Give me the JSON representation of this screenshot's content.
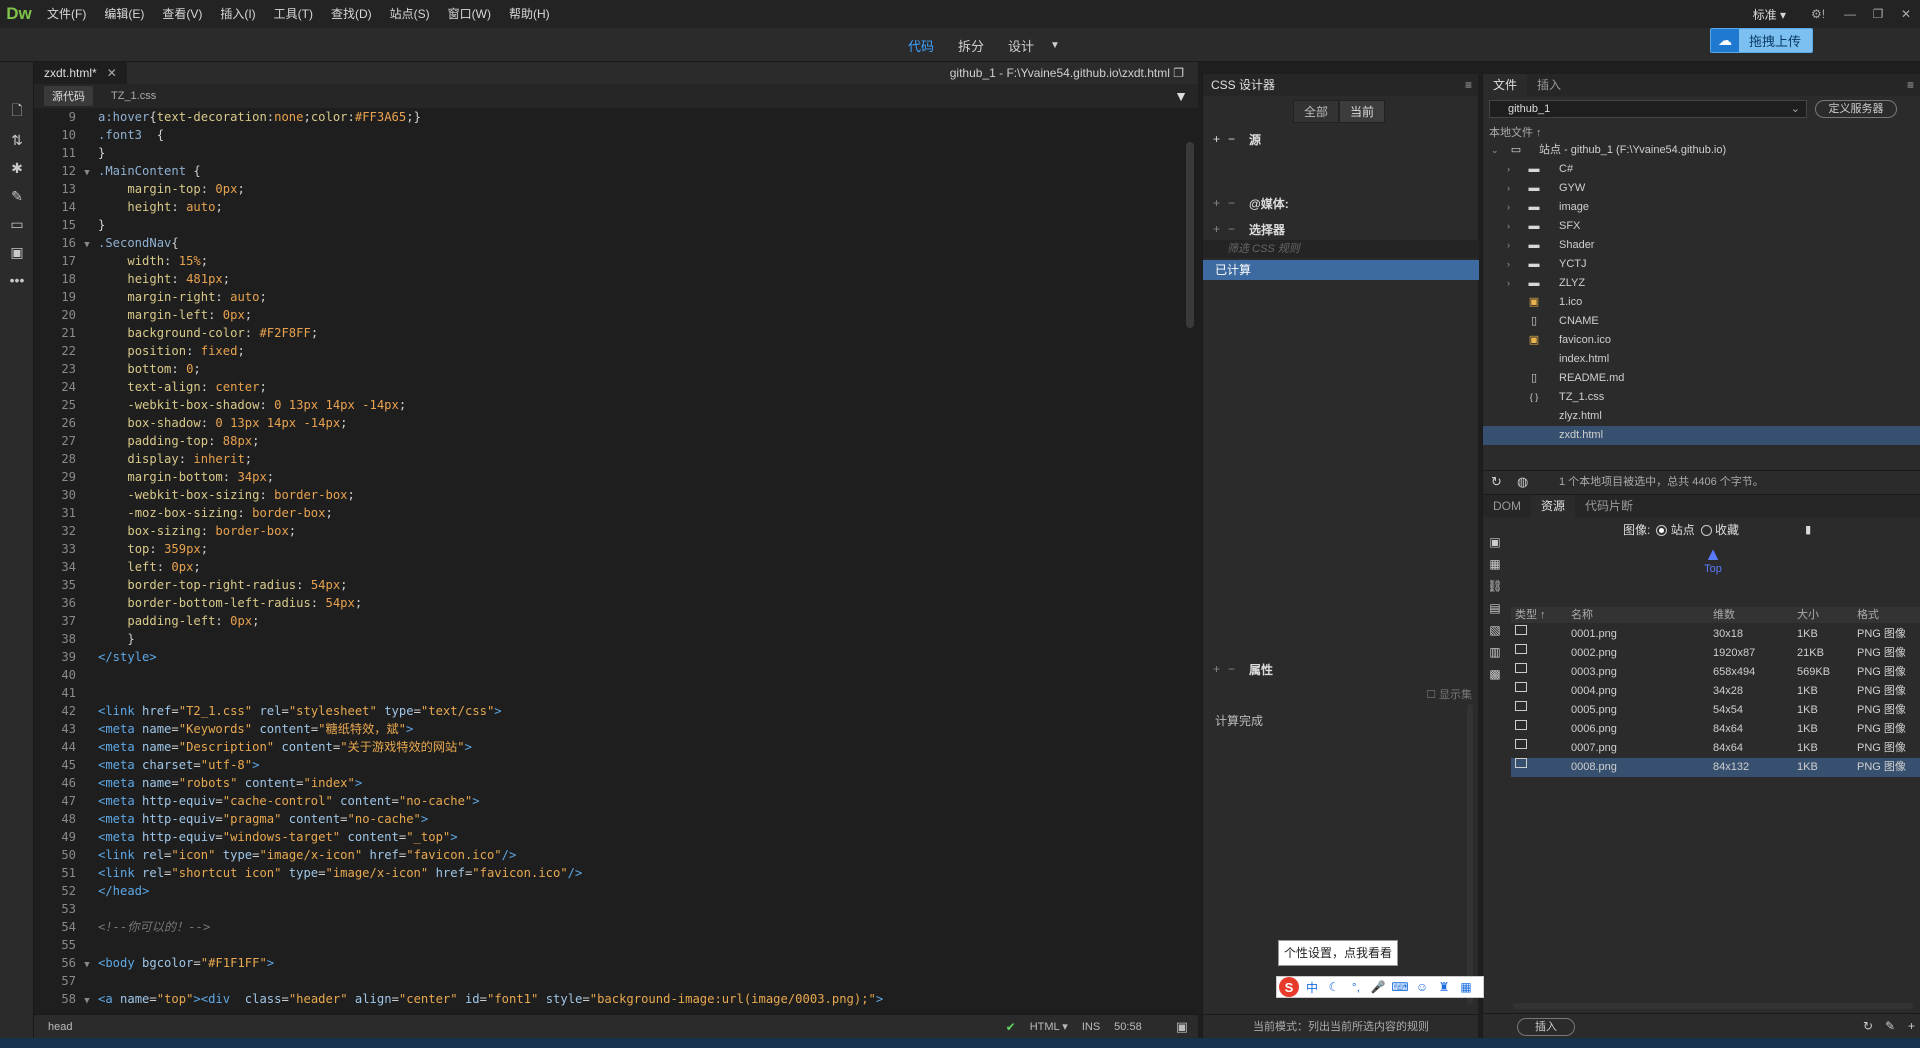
{
  "app": {
    "logo": "Dw"
  },
  "menu": [
    "文件(F)",
    "编辑(E)",
    "查看(V)",
    "插入(I)",
    "工具(T)",
    "查找(D)",
    "站点(S)",
    "窗口(W)",
    "帮助(H)"
  ],
  "workspace": "标准",
  "views": {
    "code": "代码",
    "split": "拆分",
    "design": "设计"
  },
  "upload_label": "拖拽上传",
  "doc": {
    "tab": "zxdt.html*",
    "path": "github_1 - F:\\Yvaine54.github.io\\zxdt.html",
    "subtabs": [
      "源代码",
      "TZ_1.css"
    ]
  },
  "code_lines": [
    {
      "n": "9",
      "f": "",
      "html": "<span class='c-sel'>a:hover</span>{<span class='c-prop'>text-decoration</span>:<span class='c-val'>none</span>;<span class='c-prop'>color</span>:<span class='c-val'>#FF3A65</span>;}"
    },
    {
      "n": "10",
      "f": "",
      "html": "<span class='c-sel'>.font3</span>  {"
    },
    {
      "n": "11",
      "f": "",
      "html": "}"
    },
    {
      "n": "12",
      "f": "▼",
      "html": "<span class='c-sel'>.MainContent</span> {"
    },
    {
      "n": "13",
      "f": "",
      "html": "    <span class='c-prop'>margin-top</span>: <span class='c-val'>0px</span>;"
    },
    {
      "n": "14",
      "f": "",
      "html": "    <span class='c-prop'>height</span>: <span class='c-val'>auto</span>;"
    },
    {
      "n": "15",
      "f": "",
      "html": "}"
    },
    {
      "n": "16",
      "f": "▼",
      "html": "<span class='c-sel'>.SecondNav</span>{"
    },
    {
      "n": "17",
      "f": "",
      "html": "    <span class='c-prop'>width</span>: <span class='c-val'>15%</span>;"
    },
    {
      "n": "18",
      "f": "",
      "html": "    <span class='c-prop'>height</span>: <span class='c-val'>481px</span>;"
    },
    {
      "n": "19",
      "f": "",
      "html": "    <span class='c-prop'>margin-right</span>: <span class='c-val'>auto</span>;"
    },
    {
      "n": "20",
      "f": "",
      "html": "    <span class='c-prop'>margin-left</span>: <span class='c-val'>0px</span>;"
    },
    {
      "n": "21",
      "f": "",
      "html": "    <span class='c-prop'>background-color</span>: <span class='c-val'>#F2F8FF</span>;"
    },
    {
      "n": "22",
      "f": "",
      "html": "    <span class='c-prop'>position</span>: <span class='c-val'>fixed</span>;"
    },
    {
      "n": "23",
      "f": "",
      "html": "    <span class='c-prop'>bottom</span>: <span class='c-val'>0</span>;"
    },
    {
      "n": "24",
      "f": "",
      "html": "    <span class='c-prop'>text-align</span>: <span class='c-val'>center</span>;"
    },
    {
      "n": "25",
      "f": "",
      "html": "    <span class='c-prop'>-webkit-box-shadow</span>: <span class='c-val'>0 13px 14px -14px</span>;"
    },
    {
      "n": "26",
      "f": "",
      "html": "    <span class='c-prop'>box-shadow</span>: <span class='c-val'>0 13px 14px -14px</span>;"
    },
    {
      "n": "27",
      "f": "",
      "html": "    <span class='c-prop'>padding-top</span>: <span class='c-val'>88px</span>;"
    },
    {
      "n": "28",
      "f": "",
      "html": "    <span class='c-prop'>display</span>: <span class='c-val'>inherit</span>;"
    },
    {
      "n": "29",
      "f": "",
      "html": "    <span class='c-prop'>margin-bottom</span>: <span class='c-val'>34px</span>;"
    },
    {
      "n": "30",
      "f": "",
      "html": "    <span class='c-prop'>-webkit-box-sizing</span>: <span class='c-val'>border-box</span>;"
    },
    {
      "n": "31",
      "f": "",
      "html": "    <span class='c-prop'>-moz-box-sizing</span>: <span class='c-val'>border-box</span>;"
    },
    {
      "n": "32",
      "f": "",
      "html": "    <span class='c-prop'>box-sizing</span>: <span class='c-val'>border-box</span>;"
    },
    {
      "n": "33",
      "f": "",
      "html": "    <span class='c-prop'>top</span>: <span class='c-val'>359px</span>;"
    },
    {
      "n": "34",
      "f": "",
      "html": "    <span class='c-prop'>left</span>: <span class='c-val'>0px</span>;"
    },
    {
      "n": "35",
      "f": "",
      "html": "    <span class='c-prop'>border-top-right-radius</span>: <span class='c-val'>54px</span>;"
    },
    {
      "n": "36",
      "f": "",
      "html": "    <span class='c-prop'>border-bottom-left-radius</span>: <span class='c-val'>54px</span>;"
    },
    {
      "n": "37",
      "f": "",
      "html": "    <span class='c-prop'>padding-left</span>: <span class='c-val'>0px</span>;"
    },
    {
      "n": "38",
      "f": "",
      "html": "    }"
    },
    {
      "n": "39",
      "f": "",
      "html": "<span class='c-tag'>&lt;/style&gt;</span>"
    },
    {
      "n": "40",
      "f": "",
      "html": ""
    },
    {
      "n": "41",
      "f": "",
      "html": ""
    },
    {
      "n": "42",
      "f": "",
      "html": "<span class='c-tag'>&lt;link</span> <span class='c-attr'>href</span>=<span class='c-str'>\"T2_1.css\"</span> <span class='c-attr'>rel</span>=<span class='c-str'>\"stylesheet\"</span> <span class='c-attr'>type</span>=<span class='c-str'>\"text/css\"</span><span class='c-tag'>&gt;</span>"
    },
    {
      "n": "43",
      "f": "",
      "html": "<span class='c-tag'>&lt;meta</span> <span class='c-attr'>name</span>=<span class='c-str'>\"Keywords\"</span> <span class='c-attr'>content</span>=<span class='c-str'>\"糖纸特效，斌\"</span><span class='c-tag'>&gt;</span>"
    },
    {
      "n": "44",
      "f": "",
      "html": "<span class='c-tag'>&lt;meta</span> <span class='c-attr'>name</span>=<span class='c-str'>\"Description\"</span> <span class='c-attr'>content</span>=<span class='c-str'>\"关于游戏特效的网站\"</span><span class='c-tag'>&gt;</span>"
    },
    {
      "n": "45",
      "f": "",
      "html": "<span class='c-tag'>&lt;meta</span> <span class='c-attr'>charset</span>=<span class='c-str'>\"utf-8\"</span><span class='c-tag'>&gt;</span>"
    },
    {
      "n": "46",
      "f": "",
      "html": "<span class='c-tag'>&lt;meta</span> <span class='c-attr'>name</span>=<span class='c-str'>\"robots\"</span> <span class='c-attr'>content</span>=<span class='c-str'>\"index\"</span><span class='c-tag'>&gt;</span>"
    },
    {
      "n": "47",
      "f": "",
      "html": "<span class='c-tag'>&lt;meta</span> <span class='c-attr'>http-equiv</span>=<span class='c-str'>\"cache-control\"</span> <span class='c-attr'>content</span>=<span class='c-str'>\"no-cache\"</span><span class='c-tag'>&gt;</span>"
    },
    {
      "n": "48",
      "f": "",
      "html": "<span class='c-tag'>&lt;meta</span> <span class='c-attr'>http-equiv</span>=<span class='c-str'>\"pragma\"</span> <span class='c-attr'>content</span>=<span class='c-str'>\"no-cache\"</span><span class='c-tag'>&gt;</span>"
    },
    {
      "n": "49",
      "f": "",
      "html": "<span class='c-tag'>&lt;meta</span> <span class='c-attr'>http-equiv</span>=<span class='c-str'>\"windows-target\"</span> <span class='c-attr'>content</span>=<span class='c-str'>\"_top\"</span><span class='c-tag'>&gt;</span>"
    },
    {
      "n": "50",
      "f": "",
      "html": "<span class='c-tag'>&lt;link</span> <span class='c-attr'>rel</span>=<span class='c-str'>\"icon\"</span> <span class='c-attr'>type</span>=<span class='c-str'>\"image/x-icon\"</span> <span class='c-attr'>href</span>=<span class='c-str'>\"favicon.ico\"</span><span class='c-tag'>/&gt;</span>"
    },
    {
      "n": "51",
      "f": "",
      "html": "<span class='c-tag'>&lt;link</span> <span class='c-attr'>rel</span>=<span class='c-str'>\"shortcut icon\"</span> <span class='c-attr'>type</span>=<span class='c-str'>\"image/x-icon\"</span> <span class='c-attr'>href</span>=<span class='c-str'>\"favicon.ico\"</span><span class='c-tag'>/&gt;</span>"
    },
    {
      "n": "52",
      "f": "",
      "html": "<span class='c-tag'>&lt;/head&gt;</span>"
    },
    {
      "n": "53",
      "f": "",
      "html": ""
    },
    {
      "n": "54",
      "f": "",
      "html": "<span class='c-com'>&lt;!--你可以的！--&gt;</span>"
    },
    {
      "n": "55",
      "f": "",
      "html": ""
    },
    {
      "n": "56",
      "f": "▼",
      "html": "<span class='c-tag'>&lt;body</span> <span class='c-attr'>bgcolor</span>=<span class='c-str'>\"#F1F1FF\"</span><span class='c-tag'>&gt;</span>"
    },
    {
      "n": "57",
      "f": "",
      "html": ""
    },
    {
      "n": "58",
      "f": "▼",
      "html": "<span class='c-tag'>&lt;a</span> <span class='c-attr'>name</span>=<span class='c-str'>\"top\"</span><span class='c-tag'>&gt;&lt;div</span>  <span class='c-attr'>class</span>=<span class='c-str'>\"header\"</span> <span class='c-attr'>align</span>=<span class='c-str'>\"center\"</span> <span class='c-attr'>id</span>=<span class='c-str'>\"font1\"</span> <span class='c-attr'>style</span>=<span class='c-str'>\"background-image:url(image/0003.png);\"</span><span class='c-tag'>&gt;</span>"
    }
  ],
  "status": {
    "tag": "head",
    "lang": "HTML",
    "mode": "INS",
    "pos": "50:58"
  },
  "css_designer": {
    "title": "CSS 设计器",
    "seg_all": "全部",
    "seg_current": "当前",
    "sources": "源",
    "media": "@媒体:",
    "selectors": "选择器",
    "filter_placeholder": "筛选 CSS 规则",
    "computed": "已计算",
    "properties": "属性",
    "show_set": "显示集",
    "calc_done": "计算完成",
    "footer": "当前模式：列出当前所选内容的规则"
  },
  "files": {
    "tabs": [
      "文件",
      "插入"
    ],
    "site": "github_1",
    "define_server": "定义服务器",
    "local_files": "本地文件 ↑",
    "root": "站点 - github_1 (F:\\Yvaine54.github.io)",
    "items": [
      {
        "name": "C#",
        "type": "folder"
      },
      {
        "name": "GYW",
        "type": "folder"
      },
      {
        "name": "image",
        "type": "folder"
      },
      {
        "name": "SFX",
        "type": "folder"
      },
      {
        "name": "Shader",
        "type": "folder"
      },
      {
        "name": "YCTJ",
        "type": "folder"
      },
      {
        "name": "ZLYZ",
        "type": "folder"
      },
      {
        "name": "1.ico",
        "type": "ico"
      },
      {
        "name": "CNAME",
        "type": "file"
      },
      {
        "name": "favicon.ico",
        "type": "ico"
      },
      {
        "name": "index.html",
        "type": "html"
      },
      {
        "name": "README.md",
        "type": "file"
      },
      {
        "name": "TZ_1.css",
        "type": "css"
      },
      {
        "name": "zlyz.html",
        "type": "html"
      },
      {
        "name": "zxdt.html",
        "type": "html",
        "selected": true
      }
    ],
    "status": "1 个本地项目被选中，总共 4406 个字节。"
  },
  "assets": {
    "tabs": [
      "DOM",
      "资源",
      "代码片断"
    ],
    "image_label": "图像:",
    "radio_site": "站点",
    "radio_fav": "收藏",
    "preview_text": "Top",
    "columns": [
      "类型 ↑",
      "名称",
      "维数",
      "大小",
      "格式"
    ],
    "rows": [
      {
        "name": "0001.png",
        "dim": "30x18",
        "size": "1KB",
        "fmt": "PNG 图像"
      },
      {
        "name": "0002.png",
        "dim": "1920x87",
        "size": "21KB",
        "fmt": "PNG 图像"
      },
      {
        "name": "0003.png",
        "dim": "658x494",
        "size": "569KB",
        "fmt": "PNG 图像"
      },
      {
        "name": "0004.png",
        "dim": "34x28",
        "size": "1KB",
        "fmt": "PNG 图像"
      },
      {
        "name": "0005.png",
        "dim": "54x54",
        "size": "1KB",
        "fmt": "PNG 图像"
      },
      {
        "name": "0006.png",
        "dim": "84x64",
        "size": "1KB",
        "fmt": "PNG 图像"
      },
      {
        "name": "0007.png",
        "dim": "84x64",
        "size": "1KB",
        "fmt": "PNG 图像"
      },
      {
        "name": "0008.png",
        "dim": "84x132",
        "size": "1KB",
        "fmt": "PNG 图像",
        "selected": true
      }
    ],
    "insert": "插入"
  },
  "ime": {
    "tip": "个性设置，点我看看",
    "logo": "S",
    "mode": "中"
  }
}
